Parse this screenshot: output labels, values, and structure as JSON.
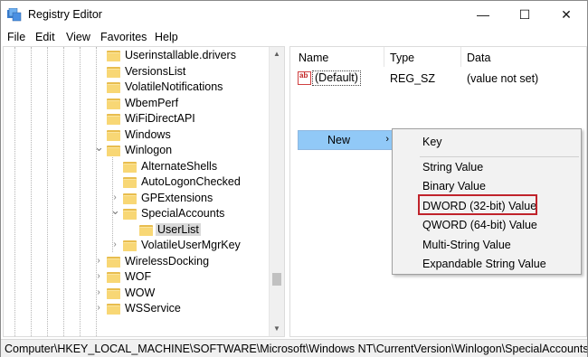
{
  "window": {
    "title": "Registry Editor"
  },
  "window_controls": {
    "minimize": "—",
    "maximize": "☐",
    "close": "✕"
  },
  "menu": [
    "File",
    "Edit",
    "View",
    "Favorites",
    "Help"
  ],
  "tree": {
    "items": [
      {
        "label": "Userinstallable.drivers",
        "expander": "",
        "depth": 0
      },
      {
        "label": "VersionsList",
        "expander": "",
        "depth": 0
      },
      {
        "label": "VolatileNotifications",
        "expander": "",
        "depth": 0
      },
      {
        "label": "WbemPerf",
        "expander": "",
        "depth": 0
      },
      {
        "label": "WiFiDirectAPI",
        "expander": "",
        "depth": 0
      },
      {
        "label": "Windows",
        "expander": "",
        "depth": 0
      },
      {
        "label": "Winlogon",
        "expander": "expanded",
        "depth": 0
      },
      {
        "label": "AlternateShells",
        "expander": "",
        "depth": 1
      },
      {
        "label": "AutoLogonChecked",
        "expander": "",
        "depth": 1
      },
      {
        "label": "GPExtensions",
        "expander": "collapsed",
        "depth": 1
      },
      {
        "label": "SpecialAccounts",
        "expander": "expanded",
        "depth": 1
      },
      {
        "label": "UserList",
        "expander": "",
        "depth": 2,
        "selected": true
      },
      {
        "label": "VolatileUserMgrKey",
        "expander": "collapsed",
        "depth": 1
      },
      {
        "label": "WirelessDocking",
        "expander": "collapsed",
        "depth": 0
      },
      {
        "label": "WOF",
        "expander": "collapsed",
        "depth": 0
      },
      {
        "label": "WOW",
        "expander": "collapsed",
        "depth": 0
      },
      {
        "label": "WSService",
        "expander": "collapsed",
        "depth": 0
      }
    ]
  },
  "values": {
    "columns": {
      "name": "Name",
      "type": "Type",
      "data": "Data"
    },
    "rows": [
      {
        "icon": "ab",
        "name": "(Default)",
        "type": "REG_SZ",
        "data": "(value not set)"
      }
    ]
  },
  "context_menu": {
    "new_label": "New",
    "arrow": "›"
  },
  "submenu": {
    "items": [
      "Key",
      "String Value",
      "Binary Value",
      "DWORD (32-bit) Value",
      "QWORD (64-bit) Value",
      "Multi-String Value",
      "Expandable String Value"
    ],
    "highlighted": "DWORD (32-bit) Value"
  },
  "status_bar": {
    "path": "Computer\\HKEY_LOCAL_MACHINE\\SOFTWARE\\Microsoft\\Windows NT\\CurrentVersion\\Winlogon\\SpecialAccounts\\UserList"
  },
  "colors": {
    "folder": "#f8d775",
    "menu_highlight": "#91c9f7",
    "annotation_box": "#c0232b",
    "selected_item": "#d9d9d9"
  }
}
